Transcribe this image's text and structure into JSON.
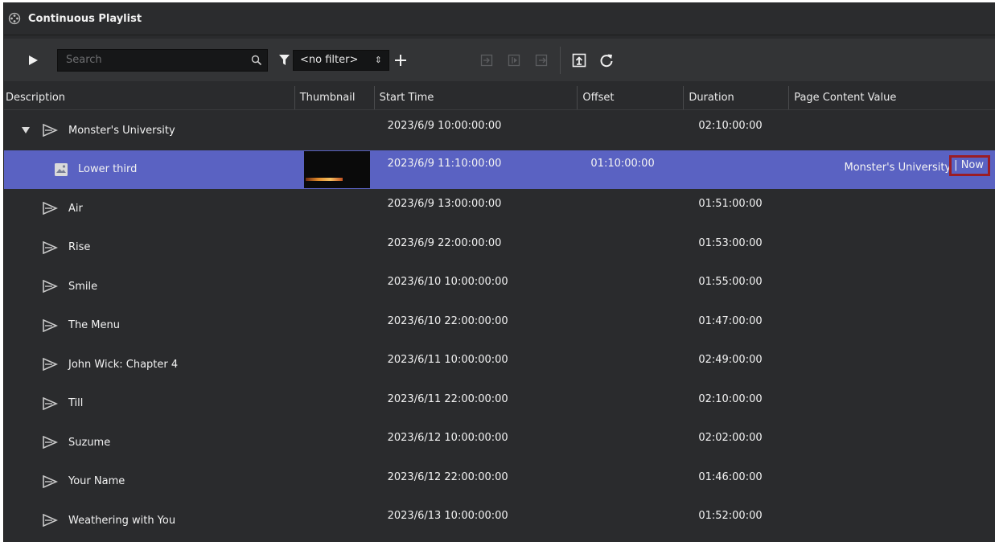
{
  "window": {
    "title": "Continuous Playlist",
    "app_icon": "film-reel-icon"
  },
  "toolbar": {
    "play_icon": "play-icon",
    "search_placeholder": "Search",
    "search_icon": "search-icon",
    "filter_icon": "filter-icon",
    "filter_value": "<no filter>",
    "filter_arrows": "⇕",
    "add_icon": "plus-icon",
    "disabled_buttons": [
      "take-in-icon",
      "cue-icon",
      "take-out-icon"
    ],
    "enabled_buttons": [
      "export-page-icon",
      "refresh-icon"
    ]
  },
  "columns": [
    "Description",
    "Thumbnail",
    "Start Time",
    "Offset",
    "Duration",
    "Page Content Value"
  ],
  "rows": [
    {
      "description": "Monster's University",
      "expanded": true,
      "icon": "playlist-triangle-icon",
      "start": "2023/6/9  10:00:00:00",
      "offset": "",
      "duration": "02:10:00:00",
      "page": "",
      "page_now": ""
    },
    {
      "description": "Lower third",
      "selected": true,
      "child": true,
      "icon": "page-image-icon",
      "thumbnail": true,
      "start": "2023/6/9  11:10:00:00",
      "offset": "01:10:00:00",
      "duration": "",
      "page": "Monster's University",
      "page_now": "Now"
    },
    {
      "description": "Air",
      "icon": "playlist-triangle-icon",
      "start": "2023/6/9  13:00:00:00",
      "offset": "",
      "duration": "01:51:00:00",
      "page": "",
      "page_now": ""
    },
    {
      "description": "Rise",
      "icon": "playlist-triangle-icon",
      "start": "2023/6/9  22:00:00:00",
      "offset": "",
      "duration": "01:53:00:00",
      "page": "",
      "page_now": ""
    },
    {
      "description": "Smile",
      "icon": "playlist-triangle-icon",
      "start": "2023/6/10  10:00:00:00",
      "offset": "",
      "duration": "01:55:00:00",
      "page": "",
      "page_now": ""
    },
    {
      "description": "The Menu",
      "icon": "playlist-triangle-icon",
      "start": "2023/6/10  22:00:00:00",
      "offset": "",
      "duration": "01:47:00:00",
      "page": "",
      "page_now": ""
    },
    {
      "description": "John Wick: Chapter 4",
      "icon": "playlist-triangle-icon",
      "start": "2023/6/11  10:00:00:00",
      "offset": "",
      "duration": "02:49:00:00",
      "page": "",
      "page_now": ""
    },
    {
      "description": "Till",
      "icon": "playlist-triangle-icon",
      "start": "2023/6/11  22:00:00:00",
      "offset": "",
      "duration": "02:10:00:00",
      "page": "",
      "page_now": ""
    },
    {
      "description": "Suzume",
      "icon": "playlist-triangle-icon",
      "start": "2023/6/12  10:00:00:00",
      "offset": "",
      "duration": "02:02:00:00",
      "page": "",
      "page_now": ""
    },
    {
      "description": "Your Name",
      "icon": "playlist-triangle-icon",
      "start": "2023/6/12  22:00:00:00",
      "offset": "",
      "duration": "01:46:00:00",
      "page": "",
      "page_now": ""
    },
    {
      "description": "Weathering with You",
      "icon": "playlist-triangle-icon",
      "start": "2023/6/13  10:00:00:00",
      "offset": "",
      "duration": "01:52:00:00",
      "page": "",
      "page_now": ""
    }
  ],
  "colors": {
    "background": "#2a2b2d",
    "selected_row": "#5a62c2",
    "now_highlight": "#9b1c24"
  }
}
